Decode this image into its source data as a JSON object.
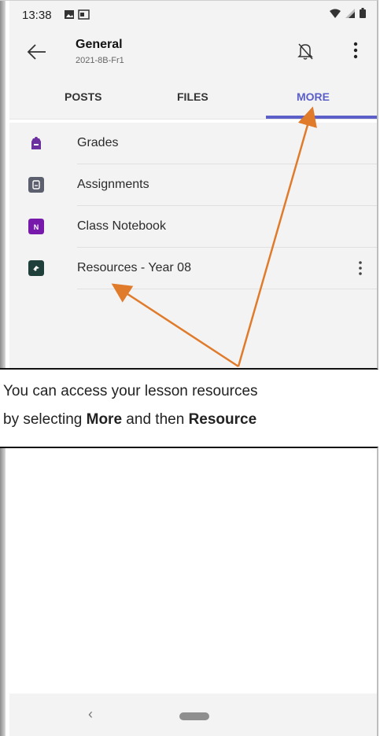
{
  "status": {
    "time": "13:38"
  },
  "header": {
    "title": "General",
    "subtitle": "2021-8B-Fr1"
  },
  "tabs": [
    {
      "label": "POSTS",
      "active": false
    },
    {
      "label": "FILES",
      "active": false
    },
    {
      "label": "MORE",
      "active": true
    }
  ],
  "items": [
    {
      "label": "Grades",
      "icon": "grades-icon",
      "color": "#6b2fa0"
    },
    {
      "label": "Assignments",
      "icon": "assignments-icon",
      "color": "#5b5f6e"
    },
    {
      "label": "Class Notebook",
      "icon": "onenote-icon",
      "color": "#7719aa"
    },
    {
      "label": "Resources - Year 08",
      "icon": "resources-icon",
      "color": "#1e3f3a"
    }
  ],
  "caption": {
    "line1": "You can access your lesson resources",
    "line2_prefix": "by selecting ",
    "line2_more": "More",
    "line2_mid": " and then ",
    "line2_resources": "Resource"
  },
  "colors": {
    "accent": "#5b5fc7",
    "arrow": "#e07b2c"
  }
}
